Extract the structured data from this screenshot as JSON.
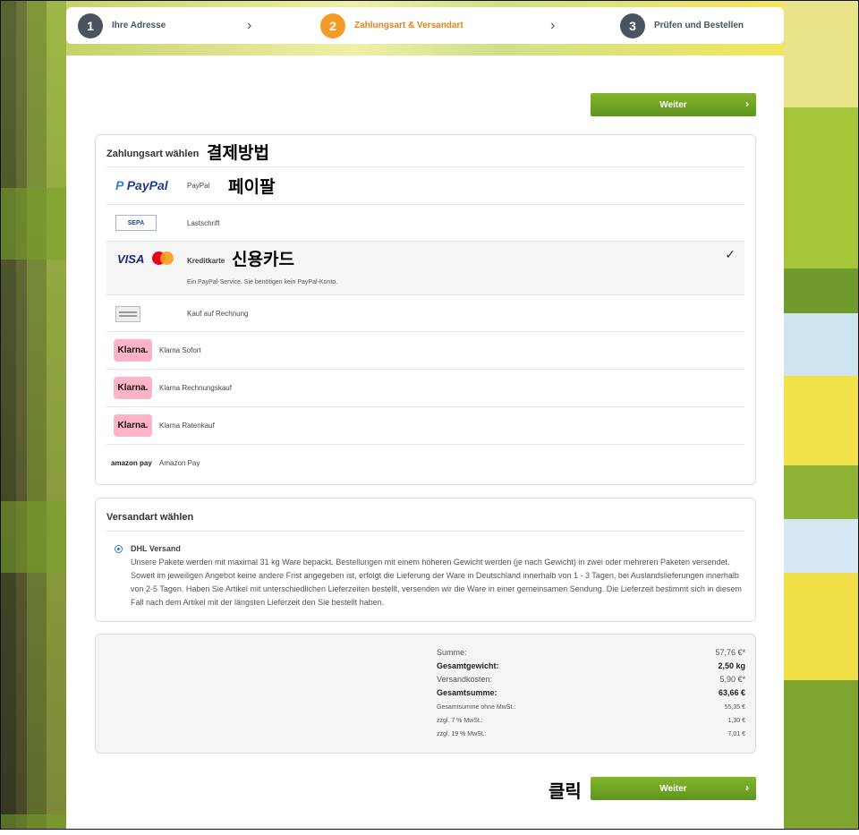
{
  "steps": [
    {
      "num": "1",
      "label": "Ihre Adresse",
      "active": false
    },
    {
      "num": "2",
      "label": "Zahlungsart & Versandart",
      "active": true
    },
    {
      "num": "3",
      "label": "Prüfen und Bestellen",
      "active": false
    }
  ],
  "buttons": {
    "weiter_top": "Weiter",
    "weiter_bottom": "Weiter"
  },
  "payment": {
    "title": "Zahlungsart wählen",
    "options": [
      {
        "logo": "PayPal",
        "name": "PayPal"
      },
      {
        "logo": "SEPA",
        "name": "Lastschrift"
      },
      {
        "logo": "VISA",
        "name": "Kreditkarte",
        "note": "Ein PayPal-Service. Sie benötigen kein PayPal-Konto.",
        "selected": true
      },
      {
        "logo": "",
        "name": "Kauf auf Rechnung"
      },
      {
        "logo": "Klarna.",
        "name": "Klarna Sofort"
      },
      {
        "logo": "Klarna.",
        "name": "Klarna Rechnungskauf"
      },
      {
        "logo": "Klarna.",
        "name": "Klarna Ratenkauf"
      },
      {
        "logo": "amazon pay",
        "name": "Amazon Pay"
      }
    ]
  },
  "shipping": {
    "title": "Versandart wählen",
    "option_name": "DHL Versand",
    "description": "Unsere Pakete werden mit maximal 31 kg Ware bepackt. Bestellungen mit einem höheren Gewicht werden (je nach Gewicht) in zwei oder mehreren Paketen versendet. Soweit im jeweiligen Angebot keine andere Frist angegeben ist, erfolgt die Lieferung der Ware in Deutschland innerhalb von 1 - 3 Tagen, bei Auslandslieferungen innerhalb von 2-5 Tagen. Haben Sie Artikel mit unterschiedlichen Lieferzeiten bestellt, versenden wir die Ware in einer gemeinsamen Sendung. Die Lieferzeit bestimmt sich in diesem Fall nach dem Artikel mit der längsten Lieferzeit den Sie bestellt haben."
  },
  "summary": [
    {
      "label": "Summe:",
      "value": "57,76 €*"
    },
    {
      "label": "Gesamtgewicht:",
      "value": "2,50 kg"
    },
    {
      "label": "Versandkosten:",
      "value": "5,90 €*"
    },
    {
      "label": "Gesamtsumme:",
      "value": "63,66 €"
    },
    {
      "label": "Gesamtsumme ohne MwSt.:",
      "value": "55,35 €"
    },
    {
      "label": "zzgl. 7 % MwSt.:",
      "value": "1,30 €"
    },
    {
      "label": "zzgl. 19 % MwSt.:",
      "value": "7,01 €"
    }
  ],
  "annotations": {
    "payment_method": "결제방법",
    "paypal": "페이팔",
    "credit_card": "신용카드",
    "click": "클릭"
  },
  "colors": {
    "accent_orange": "#f39a29",
    "button_green": "#6fa525",
    "step_gray": "#4a5360",
    "klarna_pink": "#ffb3c7"
  }
}
